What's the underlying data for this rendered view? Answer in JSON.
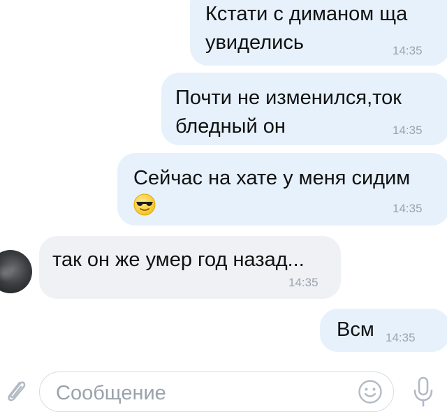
{
  "chat": {
    "messages": [
      {
        "direction": "outgoing",
        "text": "Кстати с диманом ща\nувиделись",
        "time": "14:35"
      },
      {
        "direction": "outgoing",
        "text": "Почти не изменился,ток\nбледный он",
        "time": "14:35"
      },
      {
        "direction": "outgoing",
        "text": "Сейчас на хате у меня сидим",
        "emoji": "smiling-face-with-sunglasses",
        "time": "14:35"
      },
      {
        "direction": "incoming",
        "text": "так он же умер год назад...",
        "time": "14:35"
      },
      {
        "direction": "outgoing",
        "text": "Всм",
        "time": "14:35"
      }
    ]
  },
  "composer": {
    "placeholder": "Сообщение",
    "icons": {
      "attach": "paperclip-icon",
      "emoji": "smiley-icon",
      "voice": "microphone-icon"
    }
  },
  "colors": {
    "outgoing_bubble": "#e6f1fb",
    "incoming_bubble": "#eff1f4",
    "time_text": "#9aa4b0",
    "icon": "#b2bac4"
  }
}
